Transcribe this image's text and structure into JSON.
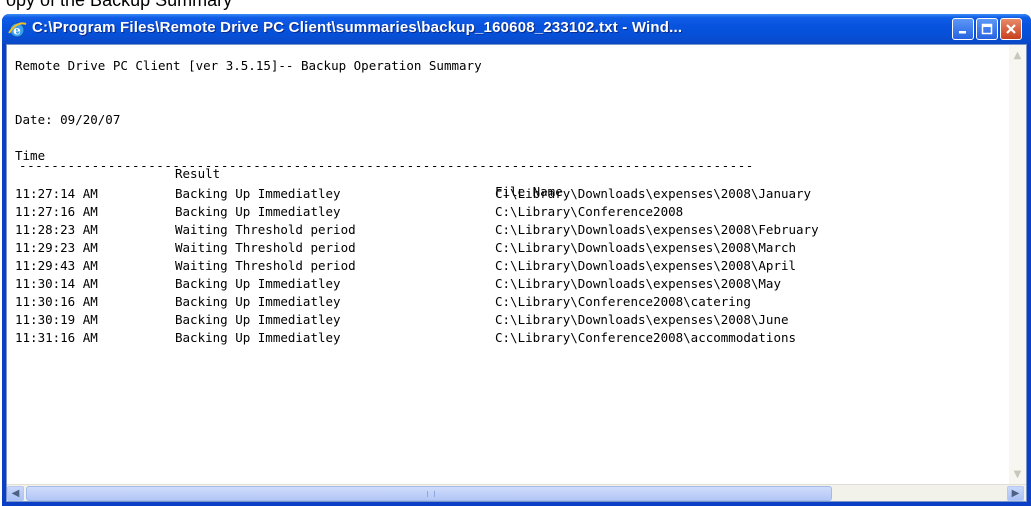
{
  "top_strip": {
    "text": "opy of the Backup Summary"
  },
  "window": {
    "title": "C:\\Program Files\\Remote Drive PC Client\\summaries\\backup_160608_233102.txt - Wind...",
    "controls": {
      "minimize": "_",
      "maximize": "□",
      "close": "X"
    }
  },
  "document": {
    "header": "Remote Drive PC Client [ver 3.5.15]-- Backup Operation Summary",
    "date_line": "Date: 09/20/07",
    "columns": {
      "time": "Time",
      "result": "Result",
      "file": "File Name"
    },
    "divider": "-------------------------------------------------------------------------------------------",
    "rows": [
      {
        "time": "11:27:14 AM",
        "result": "Backing Up Immediatley",
        "file": "C:\\Library\\Downloads\\expenses\\2008\\January"
      },
      {
        "time": "11:27:16 AM",
        "result": "Backing Up Immediatley",
        "file": "C:\\Library\\Conference2008"
      },
      {
        "time": "11:28:23 AM",
        "result": "Waiting Threshold period",
        "file": "C:\\Library\\Downloads\\expenses\\2008\\February"
      },
      {
        "time": "11:29:23 AM",
        "result": "Waiting Threshold period",
        "file": "C:\\Library\\Downloads\\expenses\\2008\\March"
      },
      {
        "time": "11:29:43 AM",
        "result": "Waiting Threshold period",
        "file": "C:\\Library\\Downloads\\expenses\\2008\\April"
      },
      {
        "time": "11:30:14 AM",
        "result": "Backing Up Immediatley",
        "file": "C:\\Library\\Downloads\\expenses\\2008\\May"
      },
      {
        "time": "11:30:16 AM",
        "result": "Backing Up Immediatley",
        "file": "C:\\Library\\Conference2008\\catering"
      },
      {
        "time": "11:30:19 AM",
        "result": "Backing Up Immediatley",
        "file": "C:\\Library\\Downloads\\expenses\\2008\\June"
      },
      {
        "time": "11:31:16 AM",
        "result": "Backing Up Immediatley",
        "file": "C:\\Library\\Conference2008\\accommodations"
      }
    ]
  },
  "icons": {
    "app": "internet-explorer-icon",
    "scroll_left": "◀",
    "scroll_right": "▶",
    "scroll_up": "▲",
    "scroll_down": "▼"
  }
}
